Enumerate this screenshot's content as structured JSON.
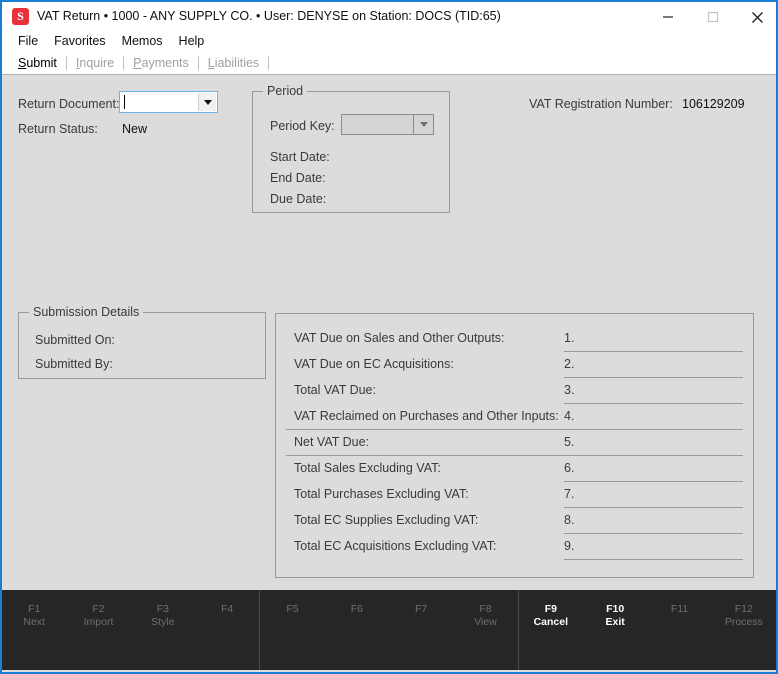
{
  "window": {
    "title": "VAT Return  •  1000 - ANY SUPPLY CO.  •  User: DENYSE on Station: DOCS (TID:65)",
    "icon_letter": "S",
    "minimize_label": "Minimize",
    "maximize_label": "Maximize",
    "close_label": "Close"
  },
  "menu": {
    "items": [
      {
        "label": "File"
      },
      {
        "label": "Favorites"
      },
      {
        "label": "Memos"
      },
      {
        "label": "Help"
      }
    ]
  },
  "tabs": [
    {
      "label": "Submit",
      "mnemonic": "S",
      "rest": "ubmit",
      "active": true
    },
    {
      "label": "Inquire",
      "mnemonic": "I",
      "rest": "nquire",
      "active": false
    },
    {
      "label": "Payments",
      "mnemonic": "P",
      "rest": "ayments",
      "active": false
    },
    {
      "label": "Liabilities",
      "mnemonic": "L",
      "rest": "iabilities",
      "active": false
    }
  ],
  "form": {
    "return_document_label": "Return Document:",
    "return_document_value": "",
    "return_status_label": "Return Status:",
    "return_status_value": "New",
    "vat_registration_label": "VAT Registration Number:",
    "vat_registration_value": "106129209"
  },
  "period": {
    "title": "Period",
    "period_key_label": "Period Key:",
    "period_key_value": "",
    "start_date_label": "Start Date:",
    "start_date_value": "",
    "end_date_label": "End Date:",
    "end_date_value": "",
    "due_date_label": "Due Date:",
    "due_date_value": ""
  },
  "submission": {
    "title": "Submission Details",
    "submitted_on_label": "Submitted On:",
    "submitted_on_value": "",
    "submitted_by_label": "Submitted By:",
    "submitted_by_value": ""
  },
  "vat_figures": [
    {
      "num": "1.",
      "label": "VAT Due on Sales and Other Outputs:",
      "value": "",
      "rule": "short"
    },
    {
      "num": "2.",
      "label": "VAT Due on EC Acquisitions:",
      "value": "",
      "rule": "short"
    },
    {
      "num": "3.",
      "label": "Total VAT Due:",
      "value": "",
      "rule": "short"
    },
    {
      "num": "4.",
      "label": "VAT Reclaimed on Purchases and Other Inputs:",
      "value": "",
      "rule": "full"
    },
    {
      "num": "5.",
      "label": "Net VAT Due:",
      "value": "",
      "rule": "full"
    },
    {
      "num": "6.",
      "label": "Total Sales Excluding VAT:",
      "value": "",
      "rule": "short"
    },
    {
      "num": "7.",
      "label": "Total Purchases Excluding VAT:",
      "value": "",
      "rule": "short"
    },
    {
      "num": "8.",
      "label": "Total EC Supplies Excluding VAT:",
      "value": "",
      "rule": "short"
    },
    {
      "num": "9.",
      "label": "Total EC Acquisitions Excluding VAT:",
      "value": "",
      "rule": "short"
    }
  ],
  "function_keys": [
    {
      "key": "F1",
      "label": "Next",
      "enabled": false
    },
    {
      "key": "F2",
      "label": "Import",
      "enabled": false
    },
    {
      "key": "F3",
      "label": "Style",
      "enabled": false
    },
    {
      "key": "F4",
      "label": "",
      "enabled": false
    },
    {
      "key": "F5",
      "label": "",
      "enabled": false
    },
    {
      "key": "F6",
      "label": "",
      "enabled": false
    },
    {
      "key": "F7",
      "label": "",
      "enabled": false
    },
    {
      "key": "F8",
      "label": "View",
      "enabled": false
    },
    {
      "key": "F9",
      "label": "Cancel",
      "enabled": true
    },
    {
      "key": "F10",
      "label": "Exit",
      "enabled": true
    },
    {
      "key": "F11",
      "label": "",
      "enabled": false
    },
    {
      "key": "F12",
      "label": "Process",
      "enabled": false
    }
  ],
  "colors": {
    "window_border": "#1a7fd4",
    "client_bg": "#dcdcdc",
    "fnbar_bg": "#262626",
    "accent_icon": "#e8313a"
  }
}
